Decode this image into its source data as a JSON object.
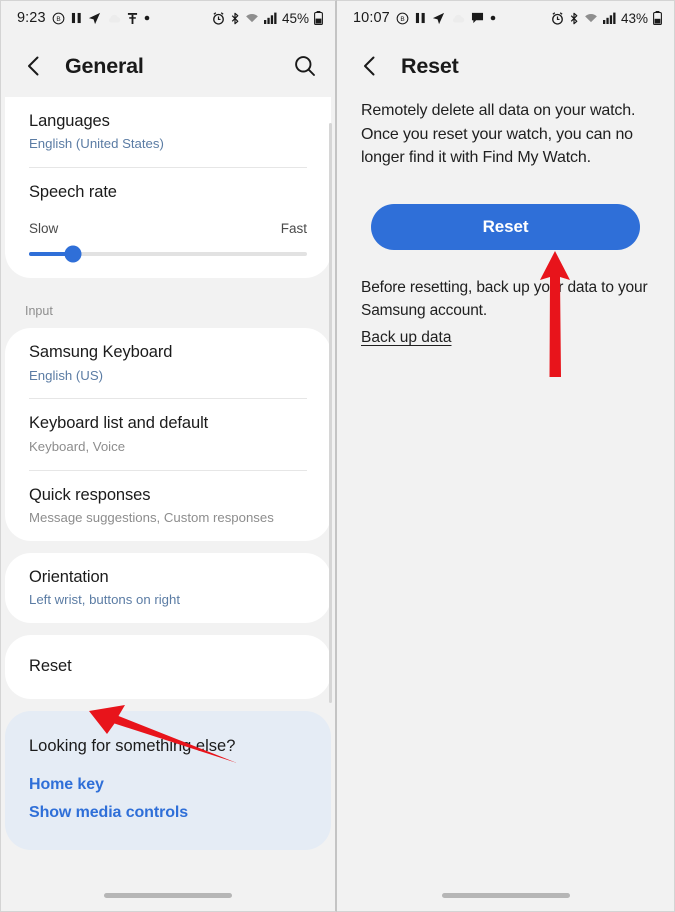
{
  "left": {
    "status": {
      "time": "9:23",
      "icons": [
        "dnd-icon",
        "pause-icon",
        "navigation-icon",
        "cloud-icon",
        "app-icon",
        "dot-icon"
      ],
      "right_icons": [
        "alarm-icon",
        "bluetooth-icon",
        "wifi-icon",
        "signal-icon"
      ],
      "battery": "45%"
    },
    "appbar": {
      "back": "back-icon",
      "title": "General",
      "search": "search-icon"
    },
    "items": [
      {
        "title": "Languages",
        "sub": "English (United States)",
        "sub_style": "blue"
      },
      {
        "title": "Speech rate",
        "type": "slider",
        "slow": "Slow",
        "fast": "Fast",
        "value": 16
      }
    ],
    "input_section_label": "Input",
    "input_items": [
      {
        "title": "Samsung Keyboard",
        "sub": "English (US)",
        "sub_style": "blue"
      },
      {
        "title": "Keyboard list and default",
        "sub": "Keyboard, Voice",
        "sub_style": "grey"
      },
      {
        "title": "Quick responses",
        "sub": "Message suggestions, Custom responses",
        "sub_style": "grey"
      }
    ],
    "orientation_item": {
      "title": "Orientation",
      "sub": "Left wrist, buttons on right",
      "sub_style": "blue"
    },
    "reset_item": {
      "title": "Reset"
    },
    "info_card": {
      "title": "Looking for something else?",
      "links": [
        "Home key",
        "Show media controls"
      ]
    }
  },
  "right": {
    "status": {
      "time": "10:07",
      "icons": [
        "dnd-icon",
        "pause-icon",
        "navigation-icon",
        "cloud-icon",
        "message-icon",
        "dot-icon"
      ],
      "right_icons": [
        "alarm-icon",
        "bluetooth-icon",
        "wifi-icon",
        "signal-icon"
      ],
      "battery": "43%"
    },
    "appbar": {
      "back": "back-icon",
      "title": "Reset"
    },
    "description": "Remotely delete all data on your watch. Once you reset your watch, you can no longer find it with Find My Watch.",
    "reset_button": "Reset",
    "note": "Before resetting, back up your data to your Samsung account.",
    "backup_link": "Back up data"
  },
  "colors": {
    "accent_blue": "#2f6fd8",
    "sub_blue": "#5b7ca4",
    "info_card_bg": "#e5ecf5",
    "page_bg": "#f2f2f2",
    "annotation_red": "#e8141b"
  }
}
